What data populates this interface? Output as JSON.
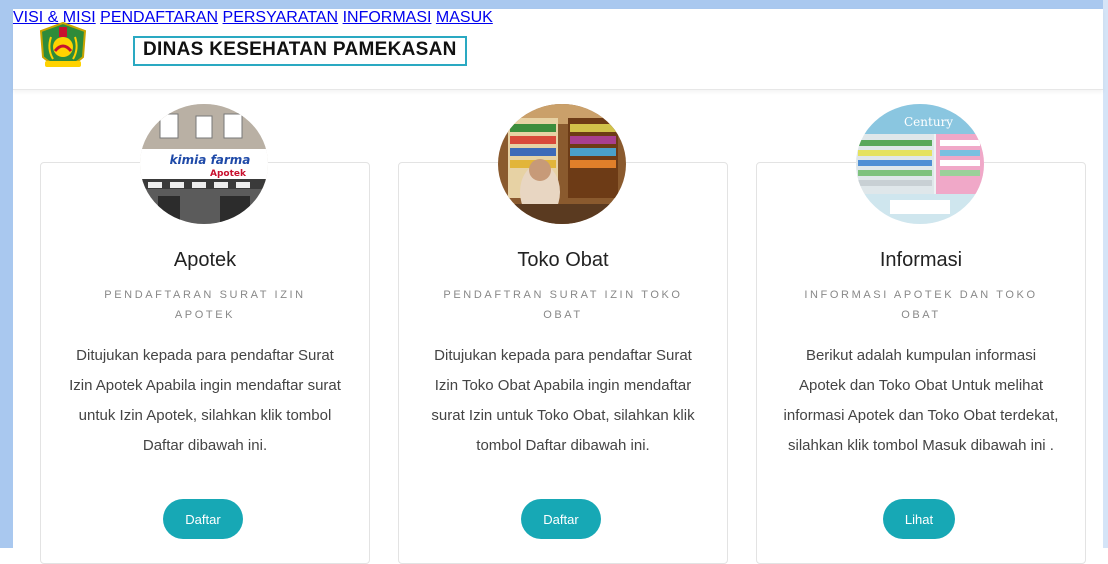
{
  "header": {
    "brand": "DINAS KESEHATAN PAMEKASAN",
    "nav": [
      {
        "label": "VISI & MISI"
      },
      {
        "label": "PENDAFTARAN"
      },
      {
        "label": "PERSYARATAN"
      },
      {
        "label": "INFORMASI"
      },
      {
        "label": "MASUK"
      }
    ]
  },
  "cards": [
    {
      "title": "Apotek",
      "subtitle": "PENDAFTARAN SURAT IZIN APOTEK",
      "description": "Ditujukan kepada para pendaftar Surat Izin Apotek Apabila ingin mendaftar surat untuk Izin Apotek, silahkan klik tombol Daftar dibawah ini.",
      "button": "Daftar",
      "image_sign": "kimia farma",
      "image_sign_sub": "Apotek"
    },
    {
      "title": "Toko Obat",
      "subtitle": "PENDAFTRAN SURAT IZIN TOKO OBAT",
      "description": "Ditujukan kepada para pendaftar Surat Izin Toko Obat Apabila ingin mendaftar surat Izin untuk Toko Obat, silahkan klik tombol Daftar dibawah ini.",
      "button": "Daftar"
    },
    {
      "title": "Informasi",
      "subtitle": "INFORMASI APOTEK DAN TOKO OBAT",
      "description": "Berikut adalah kumpulan informasi Apotek dan Toko Obat Untuk melihat informasi Apotek dan Toko Obat terdekat, silahkan klik tombol Masuk dibawah ini .",
      "button": "Lihat",
      "image_sign": "Century"
    }
  ],
  "colors": {
    "accent": "#17a8b5",
    "brand_border": "#2aa9c2",
    "frame": "#a9c8ef"
  }
}
